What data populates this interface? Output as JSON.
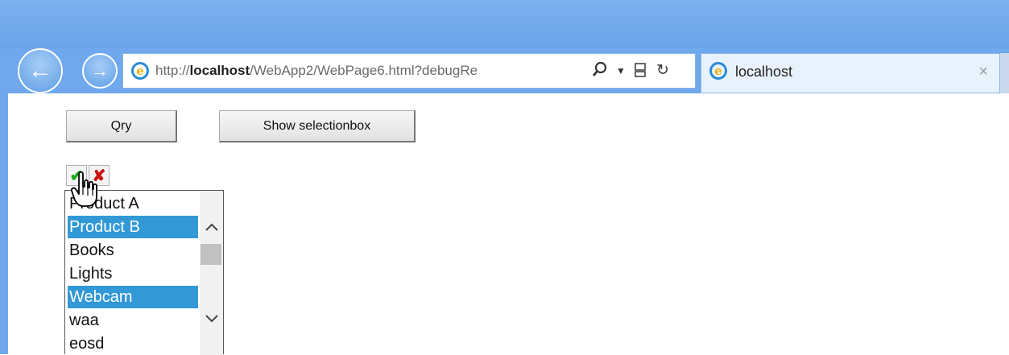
{
  "browser": {
    "address": {
      "url_prefix": "http://",
      "url_host": "localhost",
      "url_rest": "/WebApp2/WebPage6.html?debugRe"
    },
    "tab": {
      "title": "localhost",
      "close_glyph": "×"
    },
    "icons": {
      "back": "back-arrow-icon",
      "forward": "forward-arrow-icon",
      "search": "search-icon",
      "compat": "compatibility-view-icon",
      "refresh": "refresh-icon"
    }
  },
  "page": {
    "buttons": {
      "qry_label": "Qry",
      "show_label": "Show selectionbox"
    },
    "selection_box": {
      "items": [
        {
          "label": "Product A",
          "selected": false
        },
        {
          "label": "Product B",
          "selected": true
        },
        {
          "label": "Books",
          "selected": false
        },
        {
          "label": "Lights",
          "selected": false
        },
        {
          "label": "Webcam",
          "selected": true
        },
        {
          "label": "waa",
          "selected": false
        },
        {
          "label": "eosd",
          "selected": false
        }
      ]
    }
  },
  "colors": {
    "chrome": "#6fa8ec",
    "selection": "#3399d6"
  }
}
